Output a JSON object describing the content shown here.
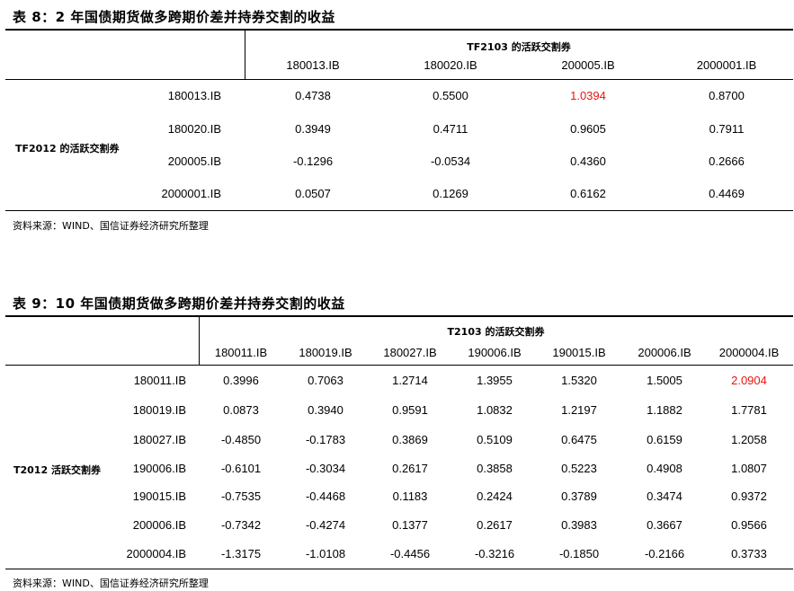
{
  "table8": {
    "caption": "表 8：2 年国债期货做多跨期价差并持券交割的收益",
    "col_group": "TF2103 的活跃交割券",
    "row_group": "TF2012 的活跃交割券",
    "columns": [
      "180013.IB",
      "180020.IB",
      "200005.IB",
      "2000001.IB"
    ],
    "rows": [
      {
        "label": "180013.IB",
        "values": [
          "0.4738",
          "0.5500",
          "1.0394",
          "0.8700"
        ],
        "highlight": [
          2
        ]
      },
      {
        "label": "180020.IB",
        "values": [
          "0.3949",
          "0.4711",
          "0.9605",
          "0.7911"
        ],
        "highlight": []
      },
      {
        "label": "200005.IB",
        "values": [
          "-0.1296",
          "-0.0534",
          "0.4360",
          "0.2666"
        ],
        "highlight": []
      },
      {
        "label": "2000001.IB",
        "values": [
          "0.0507",
          "0.1269",
          "0.6162",
          "0.4469"
        ],
        "highlight": []
      }
    ],
    "source": "资料来源：WIND、国信证券经济研究所整理"
  },
  "table9": {
    "caption": "表 9：10 年国债期货做多跨期价差并持券交割的收益",
    "col_group": "T2103 的活跃交割券",
    "row_group": "T2012 活跃交割券",
    "columns": [
      "180011.IB",
      "180019.IB",
      "180027.IB",
      "190006.IB",
      "190015.IB",
      "200006.IB",
      "2000004.IB"
    ],
    "rows": [
      {
        "label": "180011.IB",
        "values": [
          "0.3996",
          "0.7063",
          "1.2714",
          "1.3955",
          "1.5320",
          "1.5005",
          "2.0904"
        ],
        "highlight": [
          6
        ]
      },
      {
        "label": "180019.IB",
        "values": [
          "0.0873",
          "0.3940",
          "0.9591",
          "1.0832",
          "1.2197",
          "1.1882",
          "1.7781"
        ],
        "highlight": []
      },
      {
        "label": "180027.IB",
        "values": [
          "-0.4850",
          "-0.1783",
          "0.3869",
          "0.5109",
          "0.6475",
          "0.6159",
          "1.2058"
        ],
        "highlight": []
      },
      {
        "label": "190006.IB",
        "values": [
          "-0.6101",
          "-0.3034",
          "0.2617",
          "0.3858",
          "0.5223",
          "0.4908",
          "1.0807"
        ],
        "highlight": []
      },
      {
        "label": "190015.IB",
        "values": [
          "-0.7535",
          "-0.4468",
          "0.1183",
          "0.2424",
          "0.3789",
          "0.3474",
          "0.9372"
        ],
        "highlight": []
      },
      {
        "label": "200006.IB",
        "values": [
          "-0.7342",
          "-0.4274",
          "0.1377",
          "0.2617",
          "0.3983",
          "0.3667",
          "0.9566"
        ],
        "highlight": []
      },
      {
        "label": "2000004.IB",
        "values": [
          "-1.3175",
          "-1.0108",
          "-0.4456",
          "-0.3216",
          "-0.1850",
          "-0.2166",
          "0.3733"
        ],
        "highlight": []
      }
    ],
    "source": "资料来源：WIND、国信证券经济研究所整理"
  },
  "colors": {
    "highlight": "#e8140f",
    "rule": "#000000"
  }
}
